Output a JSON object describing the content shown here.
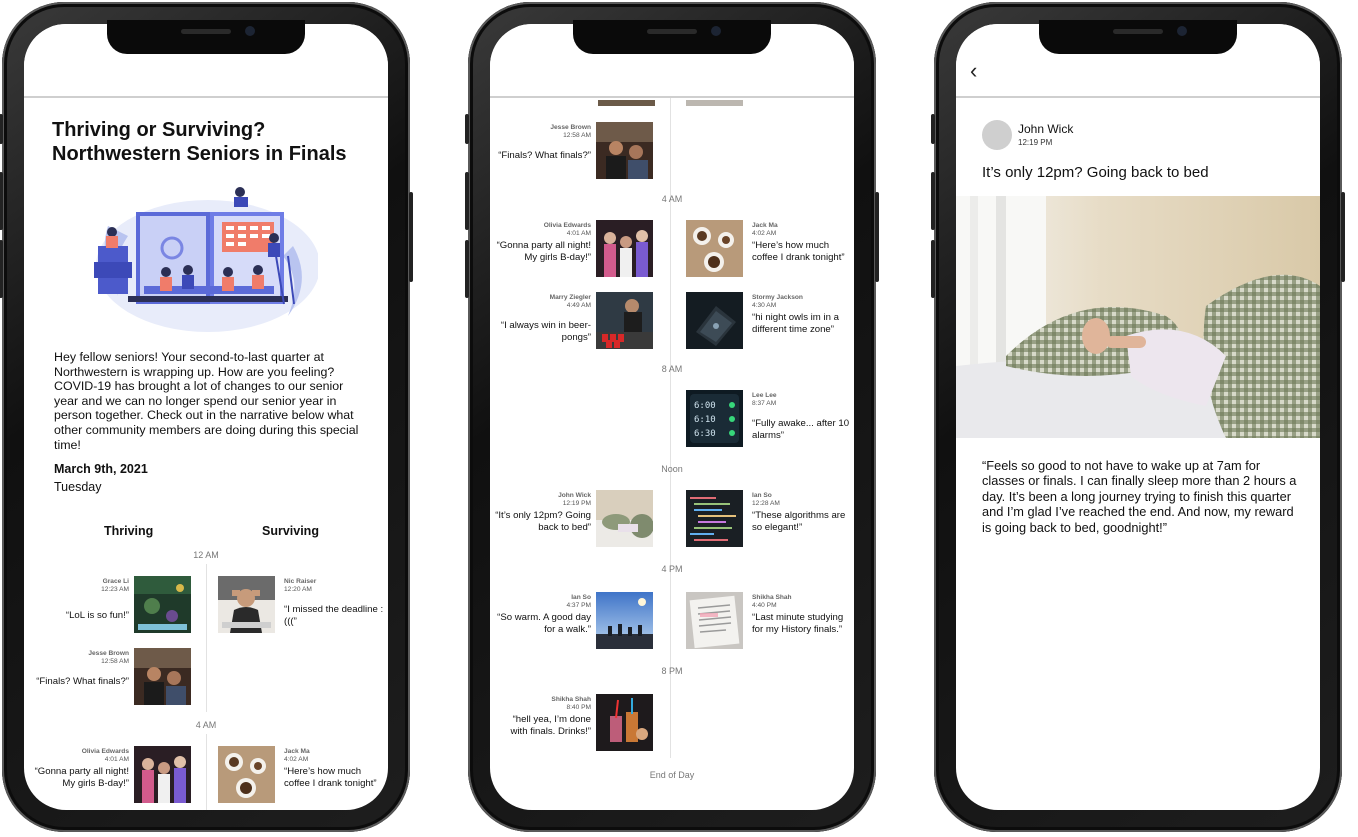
{
  "phone1": {
    "title": "Thriving or Surviving? Northwestern Seniors in Finals",
    "intro": "Hey fellow seniors! Your second-to-last quarter at Northwestern is wrapping up. How are you feeling? COVID-19 has brought a lot of changes to our senior year and we can no longer spend our senior year in person together. Check out in the narrative below what other community members are doing during this special time!",
    "date": "March 9th, 2021",
    "weekday": "Tuesday",
    "col_thriving": "Thriving",
    "col_surviving": "Surviving",
    "time_12am": "12 AM",
    "time_4am": "4 AM",
    "entries": [
      {
        "name": "Grace Li",
        "time": "12:23 AM",
        "quote": "“LoL is so fun!”"
      },
      {
        "name": "Nic Raiser",
        "time": "12:20 AM",
        "quote": "“I missed the deadline :(((”"
      },
      {
        "name": "Jesse Brown",
        "time": "12:58 AM",
        "quote": "“Finals? What finals?”"
      },
      {
        "name": "Olivia Edwards",
        "time": "4:01 AM",
        "quote": "“Gonna party all night! My girls B-day!”"
      },
      {
        "name": "Jack Ma",
        "time": "4:02 AM",
        "quote": "“Here’s how much coffee I drank tonight”"
      }
    ]
  },
  "phone2": {
    "time_4am": "4 AM",
    "time_8am": "8 AM",
    "time_noon": "Noon",
    "time_4pm": "4 PM",
    "time_8pm": "8 PM",
    "end": "End of Day",
    "entries": [
      {
        "name": "Jesse Brown",
        "time": "12:58 AM",
        "quote": "“Finals? What finals?”"
      },
      {
        "name": "Olivia Edwards",
        "time": "4:01 AM",
        "quote": "“Gonna party all night! My girls B-day!”"
      },
      {
        "name": "Jack Ma",
        "time": "4:02 AM",
        "quote": "“Here’s how much coffee I drank tonight”"
      },
      {
        "name": "Marry Ziegler",
        "time": "4:49 AM",
        "quote": "“I always win in beer-pongs”"
      },
      {
        "name": "Stormy Jackson",
        "time": "4:30 AM",
        "quote": "“hi night owls im in a different time zone”"
      },
      {
        "name": "Lee Lee",
        "time": "8:37 AM",
        "quote": "“Fully awake... after 10 alarms”"
      },
      {
        "name": "John Wick",
        "time": "12:19 PM",
        "quote": "“It’s only 12pm? Going back to bed”"
      },
      {
        "name": "Ian So",
        "time": "12:28 AM",
        "quote": "“These algorithms are so elegant!”"
      },
      {
        "name": "Ian So",
        "time": "4:37 PM",
        "quote": "“So warm. A good day for a walk.”"
      },
      {
        "name": "Shikha Shah",
        "time": "4:40 PM",
        "quote": "“Last minute studying for my History finals.”"
      },
      {
        "name": "Shikha Shah",
        "time": "8:40 PM",
        "quote": "“hell yea, I’m done with finals. Drinks!”"
      }
    ]
  },
  "phone3": {
    "back_icon": "chevron-left-icon",
    "back": "‹",
    "author": "John Wick",
    "time": "12:19 PM",
    "title": "It’s only 12pm? Going back to bed",
    "body": "“Feels so good to not have to wake up at 7am for classes or finals. I can finally sleep more than 2 hours a day. It’s been a long journey trying to finish this quarter and I’m glad I’ve reached the end. And now, my reward is going back to bed, goodnight!”"
  }
}
